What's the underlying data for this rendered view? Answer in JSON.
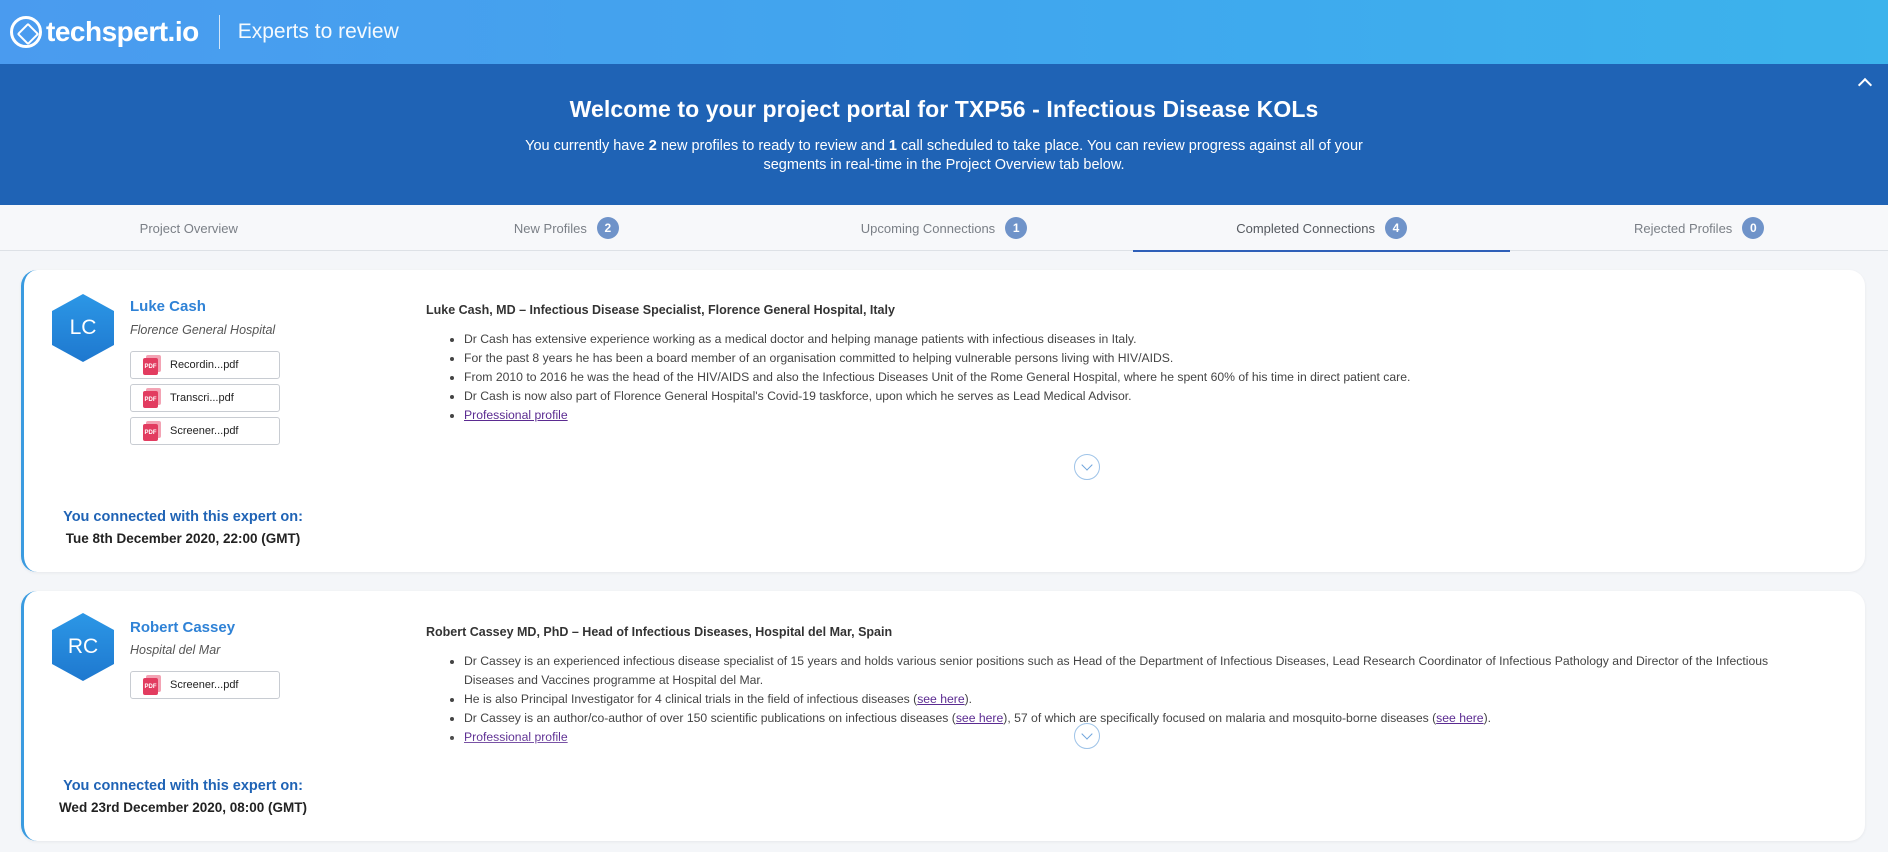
{
  "header": {
    "logo_text": "techspert.io",
    "subtitle": "Experts to review"
  },
  "banner": {
    "title": "Welcome to your project portal for TXP56 - Infectious Disease KOLs",
    "text_1": "You currently have ",
    "new_count": "2",
    "text_2": " new profiles to ready to review and ",
    "call_count": "1",
    "text_3": " call scheduled to take place. You can review progress against all of your segments in real-time in the Project Overview tab below."
  },
  "tabs": [
    {
      "label": "Project Overview",
      "badge": null
    },
    {
      "label": "New Profiles",
      "badge": "2"
    },
    {
      "label": "Upcoming Connections",
      "badge": "1"
    },
    {
      "label": "Completed Connections",
      "badge": "4",
      "active": true
    },
    {
      "label": "Rejected Profiles",
      "badge": "0"
    }
  ],
  "experts": [
    {
      "initials": "LC",
      "name": "Luke Cash",
      "org": "Florence General Hospital",
      "files": [
        "Recordin...pdf",
        "Transcri...pdf",
        "Screener...pdf"
      ],
      "connected_label": "You connected with this expert on:",
      "connected_date": "Tue 8th December 2020, 22:00 (GMT)",
      "bio_title": "Luke Cash, MD – Infectious Disease Specialist, Florence General Hospital, Italy",
      "bio_points": [
        "Dr Cash has extensive experience working as a medical doctor and helping manage patients with infectious diseases in Italy.",
        "For the past 8 years he has been a board member of an organisation committed to helping vulnerable persons living with HIV/AIDS.",
        "From 2010 to 2016 he was the head of the HIV/AIDS and also the Infectious Diseases Unit of the Rome General Hospital, where he spent 60% of his time in direct patient care.",
        "Dr Cash is now also part of Florence General Hospital's Covid-19 taskforce, upon which he serves as Lead Medical Advisor."
      ],
      "profile_link": "Professional profile"
    },
    {
      "initials": "RC",
      "name": "Robert Cassey",
      "org": "Hospital del Mar",
      "files": [
        "Screener...pdf"
      ],
      "connected_label": "You connected with this expert on:",
      "connected_date": "Wed 23rd December 2020, 08:00 (GMT)",
      "bio_title": "Robert Cassey MD, PhD – Head of Infectious Diseases, Hospital del Mar, Spain",
      "bio_point_1": "Dr Cassey is an experienced infectious disease specialist of 15 years and holds various senior positions such as Head of the Department of Infectious Diseases, Lead Research Coordinator of Infectious Pathology and Director of the Infectious Diseases and Vaccines programme at Hospital del Mar.",
      "bio_point_2_a": "He is also Principal Investigator for 4 clinical trials in the field of infectious diseases (",
      "bio_point_2_link": "see here",
      "bio_point_2_b": ").",
      "bio_point_3_a": "Dr Cassey is an author/co-author of over 150 scientific publications on infectious diseases (",
      "bio_point_3_link1": "see here",
      "bio_point_3_b": "), 57 of which are specifically focused on malaria and mosquito-borne diseases (",
      "bio_point_3_link2": "see here",
      "bio_point_3_c": ").",
      "profile_link": "Professional profile"
    }
  ],
  "icons": {
    "pdf_label": "PDF"
  },
  "colors": {
    "banner": "#1f63b5",
    "accent": "#2f82d6",
    "pdf": "#e23c60"
  }
}
